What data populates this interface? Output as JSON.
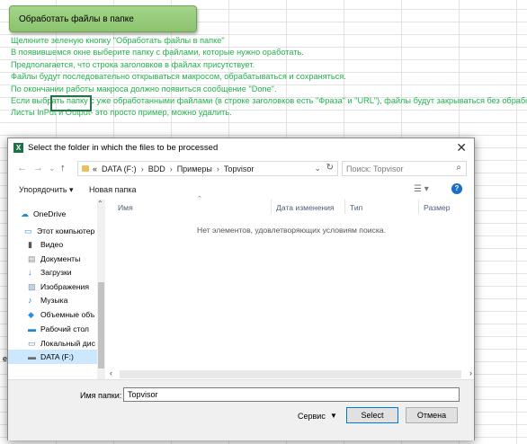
{
  "sheet": {
    "button_label": "Обработать файлы в папке",
    "lines": [
      "Щелкните зеленую кнопку \"Обработать файлы в папке\"",
      "В появившемся окне выберите папку с файлами, которые нужно оработать.",
      "Предполагается, что строка заголовков в файлах присутствует.",
      "Файлы будут последовательно открываться макросом, обрабатываться и сохраняться.",
      "По окончании работы макроса должно появиться сообщение \"Done\".",
      "Если выбрать папку с уже обработанными файлами (в строке заголовков есть \"Фраза\" и \"URL\"), файлы будут закрываться без обрабо",
      "Листы InPut и Output- это просто пример, можно удалить."
    ],
    "stray_cell": "e"
  },
  "dialog": {
    "title": "Select the folder in which the files to be processed",
    "close_symbol": "✕",
    "nav": {
      "back": "←",
      "forward": "→",
      "history": "⌄",
      "up": "↑"
    },
    "address": {
      "prefix": "«",
      "crumbs": [
        "DATA (F:)",
        "BDD",
        "Примеры",
        "Topvisor"
      ],
      "separator": "›"
    },
    "search_placeholder": "Поиск: Topvisor",
    "toolbar": {
      "organize": "Упорядочить ▾",
      "new_folder": "Новая папка"
    },
    "nav_items": [
      {
        "label": "OneDrive",
        "icon": "cloud-icon",
        "color": "#1e88e5"
      },
      {
        "label": "Этот компьютер",
        "icon": "computer-icon",
        "color": "#3d8bd1"
      },
      {
        "label": "Видео",
        "icon": "video-icon",
        "color": "#555555"
      },
      {
        "label": "Документы",
        "icon": "documents-icon",
        "color": "#8a8a8a"
      },
      {
        "label": "Загрузки",
        "icon": "downloads-icon",
        "color": "#1a74d2"
      },
      {
        "label": "Изображения",
        "icon": "pictures-icon",
        "color": "#6d8fae"
      },
      {
        "label": "Музыка",
        "icon": "music-icon",
        "color": "#1a74d2"
      },
      {
        "label": "Объемные объ",
        "icon": "3d-objects-icon",
        "color": "#2a8fe3"
      },
      {
        "label": "Рабочий стол",
        "icon": "desktop-icon",
        "color": "#1f86d6"
      },
      {
        "label": "Локальный дис",
        "icon": "local-disk-icon",
        "color": "#5a7a99"
      },
      {
        "label": "DATA (F:)",
        "icon": "drive-icon",
        "color": "#6b6b6b"
      }
    ],
    "columns": [
      "Имя",
      "Дата изменения",
      "Тип",
      "Размер"
    ],
    "empty_message": "Нет элементов, удовлетворяющих условиям поиска.",
    "filename_label": "Имя папки:",
    "filename_value": "Topvisor",
    "service_label": "Сервис",
    "select_label": "Select",
    "cancel_label": "Отмена"
  }
}
